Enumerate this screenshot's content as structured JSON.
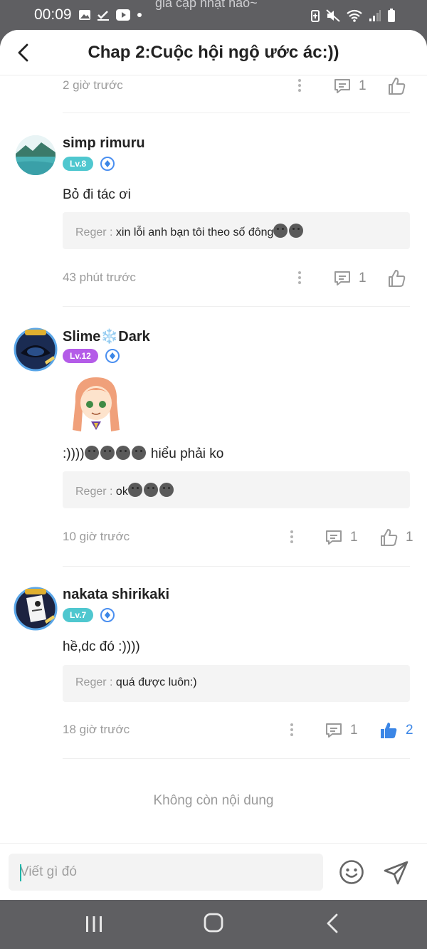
{
  "status_bar": {
    "time": "00:09",
    "notification_text": "gia cập nhật nào~"
  },
  "header": {
    "title": "Chap 2:Cuộc hội ngộ ước ác:))"
  },
  "top_meta": {
    "time": "2 giờ trước",
    "reply_count": "1"
  },
  "comments": [
    {
      "username": "simp rimuru",
      "level": "Lv.8",
      "text": "Bỏ đi tác ơi",
      "reply_user": "Reger : ",
      "reply_text": "xin lỗi anh bạn tôi theo số đông",
      "time": "43 phút trước",
      "reply_count": "1",
      "like_count": ""
    },
    {
      "username": "Slime❄️Dark",
      "level": "Lv.12",
      "text_before": ":))))",
      "text_after": " hiểu phải ko",
      "reply_user": "Reger : ",
      "reply_text": "ok",
      "time": "10 giờ trước",
      "reply_count": "1",
      "like_count": "1"
    },
    {
      "username": "nakata shirikaki",
      "level": "Lv.7",
      "text": "hề,dc đó :))))",
      "reply_user": "Reger : ",
      "reply_text": "quá được luôn:)",
      "time": "18 giờ trước",
      "reply_count": "1",
      "like_count": "2"
    }
  ],
  "end_text": "Không còn nội dung",
  "input": {
    "placeholder": "Viết gì đó"
  },
  "colors": {
    "accent_blue": "#3b86e6",
    "level_teal": "#4fc7cf",
    "level_purple": "#b45ce8",
    "system_bar": "#5f5f62"
  }
}
